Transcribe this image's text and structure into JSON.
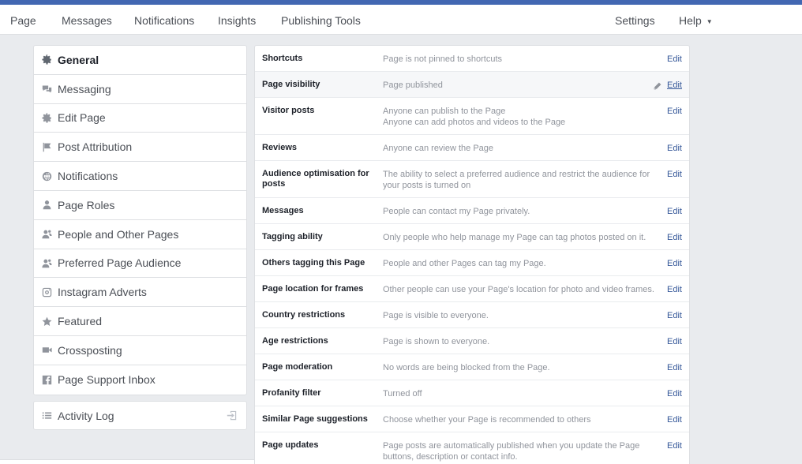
{
  "topnav": {
    "left": [
      "Page",
      "Messages",
      "Notifications",
      "Insights",
      "Publishing Tools"
    ],
    "settings": "Settings",
    "help": "Help"
  },
  "sidebar": {
    "items": [
      {
        "label": "General",
        "icon": "gear-icon"
      },
      {
        "label": "Messaging",
        "icon": "messaging-icon"
      },
      {
        "label": "Edit Page",
        "icon": "gear-icon"
      },
      {
        "label": "Post Attribution",
        "icon": "flag-icon"
      },
      {
        "label": "Notifications",
        "icon": "globe-icon"
      },
      {
        "label": "Page Roles",
        "icon": "person-icon"
      },
      {
        "label": "People and Other Pages",
        "icon": "people-icon"
      },
      {
        "label": "Preferred Page Audience",
        "icon": "people-icon"
      },
      {
        "label": "Instagram Adverts",
        "icon": "instagram-icon"
      },
      {
        "label": "Featured",
        "icon": "star-icon"
      },
      {
        "label": "Crossposting",
        "icon": "video-icon"
      },
      {
        "label": "Page Support Inbox",
        "icon": "facebook-icon"
      }
    ],
    "activity_log": "Activity Log"
  },
  "settings": {
    "edit_label": "Edit",
    "rows": [
      {
        "label": "Shortcuts",
        "value": "Page is not pinned to shortcuts"
      },
      {
        "label": "Page visibility",
        "value": "Page published"
      },
      {
        "label": "Visitor posts",
        "value": "Anyone can publish to the Page",
        "value2": "Anyone can add photos and videos to the Page"
      },
      {
        "label": "Reviews",
        "value": "Anyone can review the Page"
      },
      {
        "label": "Audience optimisation for posts",
        "value": "The ability to select a preferred audience and restrict the audience for your posts is turned on"
      },
      {
        "label": "Messages",
        "value": "People can contact my Page privately."
      },
      {
        "label": "Tagging ability",
        "value": "Only people who help manage my Page can tag photos posted on it."
      },
      {
        "label": "Others tagging this Page",
        "value": "People and other Pages can tag my Page."
      },
      {
        "label": "Page location for frames",
        "value": "Other people can use your Page's location for photo and video frames."
      },
      {
        "label": "Country restrictions",
        "value": "Page is visible to everyone."
      },
      {
        "label": "Age restrictions",
        "value": "Page is shown to everyone."
      },
      {
        "label": "Page moderation",
        "value": "No words are being blocked from the Page."
      },
      {
        "label": "Profanity filter",
        "value": "Turned off"
      },
      {
        "label": "Similar Page suggestions",
        "value": "Choose whether your Page is recommended to others"
      },
      {
        "label": "Page updates",
        "value": "Page posts are automatically published when you update the Page buttons, description or contact info."
      }
    ]
  },
  "colors": {
    "brand": "#4267b2",
    "link": "#365899",
    "background": "#e9ebee",
    "muted_text": "#90949c"
  }
}
